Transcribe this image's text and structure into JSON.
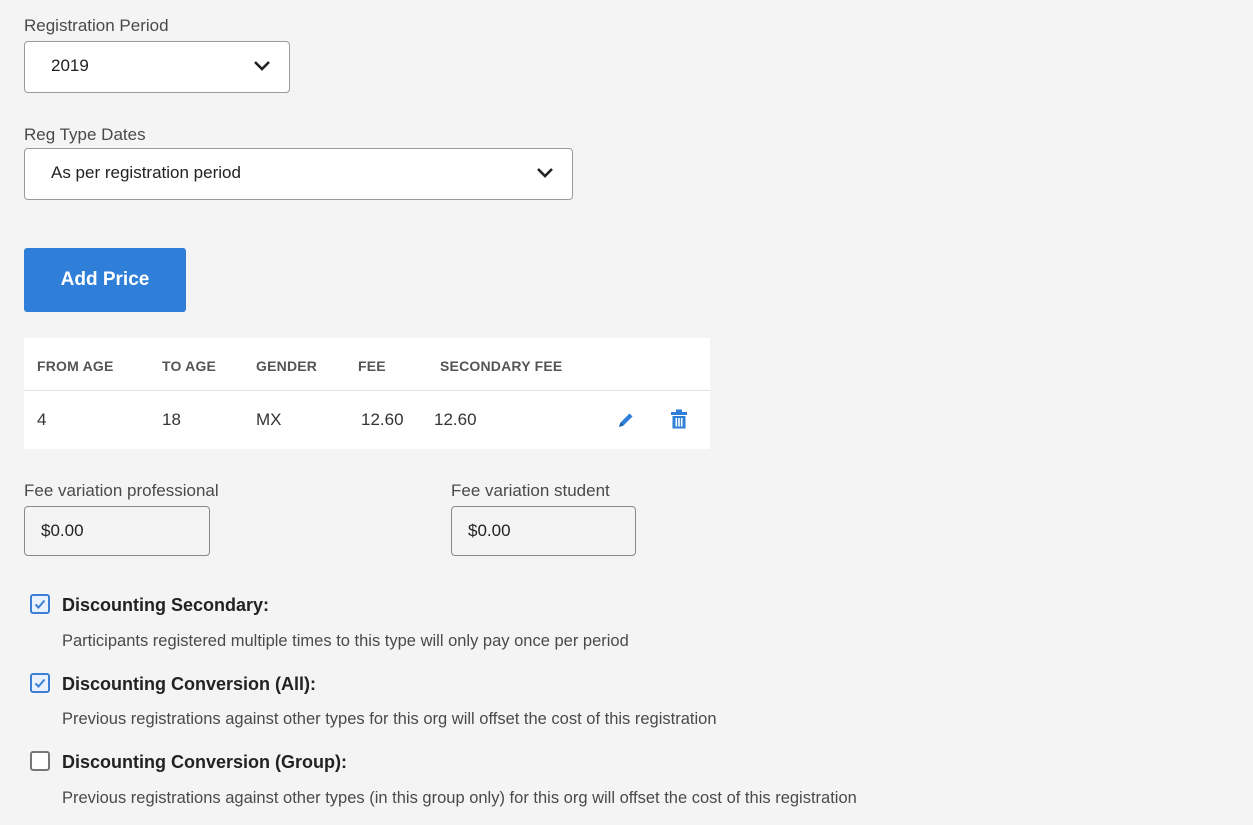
{
  "registration_period": {
    "label": "Registration Period",
    "selected": "2019"
  },
  "reg_type_dates": {
    "label": "Reg Type Dates",
    "selected": "As per registration period"
  },
  "add_price_button": "Add Price",
  "price_table": {
    "headers": [
      "FROM AGE",
      "TO AGE",
      "GENDER",
      "FEE",
      "SECONDARY FEE"
    ],
    "rows": [
      {
        "from_age": "4",
        "to_age": "18",
        "gender": "MX",
        "fee": "12.60",
        "secondary_fee": "12.60"
      }
    ],
    "icons": {
      "edit": "pencil-icon",
      "delete": "trash-icon"
    }
  },
  "fee_variation_professional": {
    "label": "Fee variation professional",
    "value": "$0.00"
  },
  "fee_variation_student": {
    "label": "Fee variation student",
    "value": "$0.00"
  },
  "options": [
    {
      "title": "Discounting Secondary:",
      "description": "Participants registered multiple times to this type will only pay once per period",
      "checked": true
    },
    {
      "title": "Discounting Conversion (All):",
      "description": "Previous registrations against other types for this org will offset the cost of this registration",
      "checked": true
    },
    {
      "title": "Discounting Conversion (Group):",
      "description": "Previous registrations against other types (in this group only) for this org will offset the cost of this registration",
      "checked": false
    }
  ],
  "colors": {
    "accent": "#2f7fd8",
    "background": "#f4f4f4",
    "check": "#3c7fd4"
  }
}
